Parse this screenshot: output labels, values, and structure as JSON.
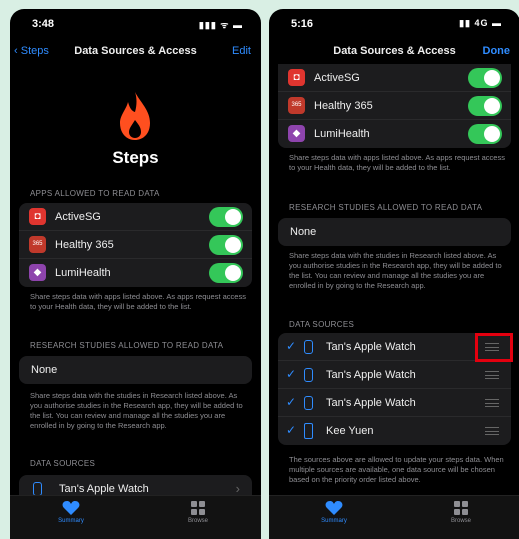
{
  "left": {
    "status": {
      "time": "3:48",
      "signal": "▮▮▮ ᯤ ▬"
    },
    "nav": {
      "back": "Steps",
      "title": "Data Sources & Access",
      "action": "Edit"
    },
    "hero": {
      "title": "Steps"
    },
    "apps_label": "APPS ALLOWED TO READ DATA",
    "apps": [
      {
        "label": "ActiveSG",
        "icon": "activesg-icon",
        "color": "#e0352f",
        "glyph": "◘"
      },
      {
        "label": "Healthy 365",
        "icon": "healthy365-icon",
        "color": "#c0392b",
        "glyph": "365"
      },
      {
        "label": "LumiHealth",
        "icon": "lumihealth-icon",
        "color": "#8e44ad",
        "glyph": "◆"
      }
    ],
    "apps_note": "Share steps data with apps listed above. As apps request access to your Health data, they will be added to the list.",
    "research_label": "RESEARCH STUDIES ALLOWED TO READ DATA",
    "research_value": "None",
    "research_note": "Share steps data with the studies in Research listed above. As you authorise studies in the Research app, they will be added to the list. You can review and manage all the studies you are enrolled in by going to the Research app.",
    "sources_label": "DATA SOURCES",
    "source": "Tan's Apple Watch",
    "chevron": "›",
    "tabs": {
      "summary": "Summary",
      "browse": "Browse"
    }
  },
  "right": {
    "status": {
      "time": "5:16",
      "signal": "▮▮ 4G ▬"
    },
    "nav": {
      "title": "Data Sources & Access",
      "action": "Done"
    },
    "apps": [
      {
        "label": "ActiveSG",
        "icon": "activesg-icon",
        "color": "#e0352f",
        "glyph": "◘"
      },
      {
        "label": "Healthy 365",
        "icon": "healthy365-icon",
        "color": "#c0392b",
        "glyph": "365"
      },
      {
        "label": "LumiHealth",
        "icon": "lumihealth-icon",
        "color": "#8e44ad",
        "glyph": "◆"
      }
    ],
    "apps_note": "Share steps data with apps listed above. As apps request access to your Health data, they will be added to the list.",
    "research_label": "RESEARCH STUDIES ALLOWED TO READ DATA",
    "research_value": "None",
    "research_note": "Share steps data with the studies in Research listed above. As you authorise studies in the Research app, they will be added to the list. You can review and manage all the studies you are enrolled in by going to the Research app.",
    "sources_label": "DATA SOURCES",
    "sources": [
      {
        "label": "Tan's Apple Watch",
        "check": "✓"
      },
      {
        "label": "Tan's Apple Watch",
        "check": "✓"
      },
      {
        "label": "Tan's Apple Watch",
        "check": "✓"
      },
      {
        "label": "Kee Yuen",
        "check": "✓"
      }
    ],
    "sources_note": "The sources above are allowed to update your steps data. When multiple sources are available, one data source will be chosen based on the priority order listed above.",
    "tabs": {
      "summary": "Summary",
      "browse": "Browse"
    }
  },
  "colors": {
    "accent": "#2f8cff",
    "toggle_on": "#34c759",
    "highlight": "#e4000f",
    "flame": "#ff4f1f"
  }
}
